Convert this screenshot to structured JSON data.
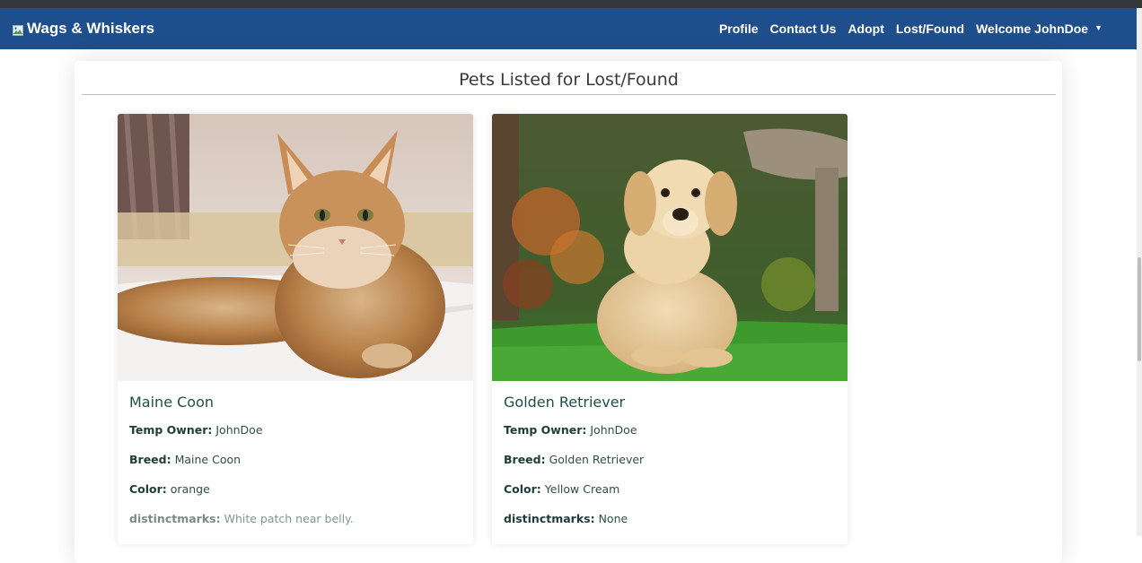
{
  "navbar": {
    "brand": "Wags & Whiskers",
    "links": {
      "profile": "Profile",
      "contact": "Contact Us",
      "adopt": "Adopt",
      "lost_found": "Lost/Found",
      "welcome": "Welcome JohnDoe"
    },
    "background": "#1f4e8c"
  },
  "page": {
    "header": "Pets Listed for Lost/Found"
  },
  "labels": {
    "temp_owner": "Temp Owner:",
    "breed": "Breed:",
    "color": "Color:",
    "distinctmarks": "distinctmarks:"
  },
  "pets": [
    {
      "name": "Maine Coon",
      "temp_owner": "JohnDoe",
      "breed": "Maine Coon",
      "color": "orange",
      "distinctmarks": "White patch near belly."
    },
    {
      "name": "Golden Retriever",
      "temp_owner": "JohnDoe",
      "breed": "Golden Retriever",
      "color": "Yellow Cream",
      "distinctmarks": "None"
    }
  ]
}
